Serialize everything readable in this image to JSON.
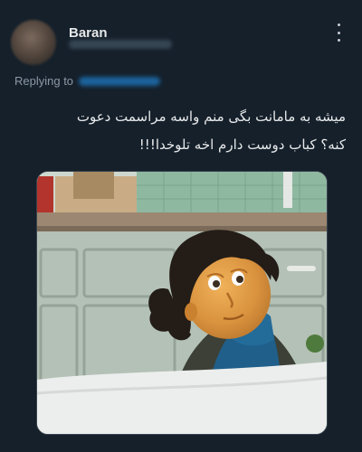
{
  "tweet": {
    "author_name": "Baran",
    "replying_label": "Replying to",
    "text_lines": [
      "میشه به مامانت بگی منم واسه مراسمت دعوت",
      "کنه؟ کباب دوست دارم اخه تلوخدا!!!"
    ]
  },
  "icons": {
    "more": "more-vertical-icon"
  },
  "colors": {
    "background": "#15202b",
    "text": "#e7e9ea",
    "secondary_text": "#8b98a5",
    "link": "#1d9bf0"
  }
}
